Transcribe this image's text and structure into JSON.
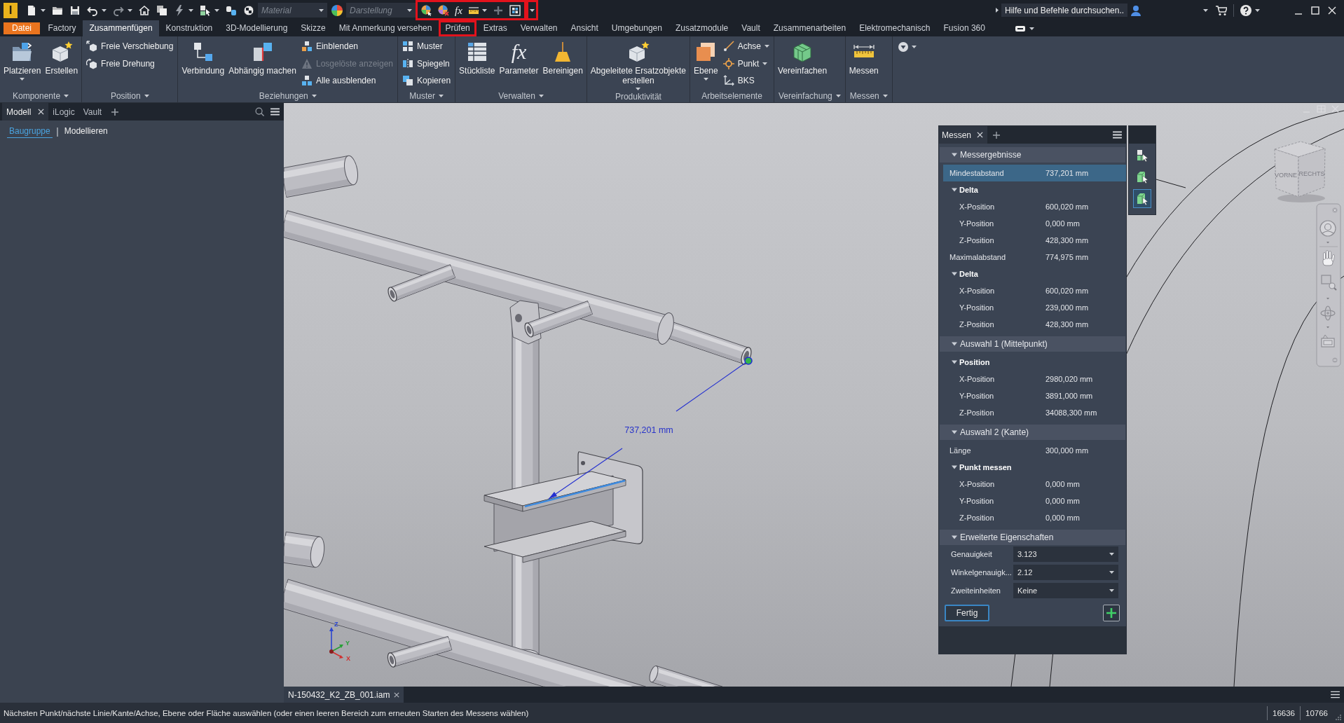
{
  "title_bar": {
    "app_logo": "I",
    "material": {
      "placeholder": "Material"
    },
    "appearance": {
      "placeholder": "Darstellung"
    },
    "quick_tools": {
      "highlighted": true,
      "formula_glyph": "fx"
    },
    "customize": {
      "highlighted": true
    },
    "search": {
      "placeholder": "Hilfe und Befehle durchsuchen.."
    }
  },
  "ribbon_tabs": [
    {
      "label": "Datei",
      "kind": "file",
      "selected": false,
      "highlighted": false
    },
    {
      "label": "Factory",
      "kind": "tab",
      "selected": false,
      "highlighted": false
    },
    {
      "label": "Zusammenfügen",
      "kind": "tab",
      "selected": true,
      "highlighted": false
    },
    {
      "label": "Konstruktion",
      "kind": "tab",
      "selected": false,
      "highlighted": false
    },
    {
      "label": "3D-Modellierung",
      "kind": "tab",
      "selected": false,
      "highlighted": false
    },
    {
      "label": "Skizze",
      "kind": "tab",
      "selected": false,
      "highlighted": false
    },
    {
      "label": "Mit Anmerkung versehen",
      "kind": "tab",
      "selected": false,
      "highlighted": false
    },
    {
      "label": "Prüfen",
      "kind": "tab",
      "selected": false,
      "highlighted": true
    },
    {
      "label": "Extras",
      "kind": "tab",
      "selected": false,
      "highlighted": false
    },
    {
      "label": "Verwalten",
      "kind": "tab",
      "selected": false,
      "highlighted": false
    },
    {
      "label": "Ansicht",
      "kind": "tab",
      "selected": false,
      "highlighted": false
    },
    {
      "label": "Umgebungen",
      "kind": "tab",
      "selected": false,
      "highlighted": false
    },
    {
      "label": "Zusatzmodule",
      "kind": "tab",
      "selected": false,
      "highlighted": false
    },
    {
      "label": "Vault",
      "kind": "tab",
      "selected": false,
      "highlighted": false
    },
    {
      "label": "Zusammenarbeiten",
      "kind": "tab",
      "selected": false,
      "highlighted": false
    },
    {
      "label": "Elektromechanisch",
      "kind": "tab",
      "selected": false,
      "highlighted": false
    },
    {
      "label": "Fusion 360",
      "kind": "tab",
      "selected": false,
      "highlighted": false
    }
  ],
  "ribbon_panels": [
    {
      "title": "Komponente",
      "menu": true,
      "buttons": [
        {
          "label": "Platzieren",
          "kind": "large",
          "menu": true,
          "disabled": false
        },
        {
          "label": "Erstellen",
          "kind": "large",
          "menu": false,
          "disabled": false
        }
      ]
    },
    {
      "title": "Position",
      "menu": true,
      "buttons": [
        {
          "label": "Freie Verschiebung",
          "kind": "small",
          "menu": false,
          "disabled": false
        },
        {
          "label": "Freie Drehung",
          "kind": "small",
          "menu": false,
          "disabled": false
        }
      ]
    },
    {
      "title": "Beziehungen",
      "menu": true,
      "buttons": [
        {
          "label": "Verbindung",
          "kind": "large",
          "menu": false,
          "disabled": false
        },
        {
          "label": "Abhängig machen",
          "kind": "large",
          "menu": false,
          "disabled": false
        },
        {
          "label": "Einblenden",
          "kind": "small",
          "menu": false,
          "disabled": false
        },
        {
          "label": "Losgelöste anzeigen",
          "kind": "small",
          "menu": false,
          "disabled": true
        },
        {
          "label": "Alle ausblenden",
          "kind": "small",
          "menu": false,
          "disabled": false
        }
      ]
    },
    {
      "title": "Muster",
      "menu": true,
      "buttons": [
        {
          "label": "Muster",
          "kind": "small",
          "menu": false,
          "disabled": false
        },
        {
          "label": "Spiegeln",
          "kind": "small",
          "menu": false,
          "disabled": false
        },
        {
          "label": "Kopieren",
          "kind": "small",
          "menu": false,
          "disabled": false
        }
      ]
    },
    {
      "title": "Verwalten",
      "menu": true,
      "buttons": [
        {
          "label": "Stückliste",
          "kind": "large",
          "menu": false,
          "disabled": false
        },
        {
          "label": "Parameter",
          "kind": "large",
          "menu": false,
          "disabled": false,
          "glyph": "fx"
        },
        {
          "label": "Bereinigen",
          "kind": "large",
          "menu": false,
          "disabled": false
        }
      ]
    },
    {
      "title": "Produktivität",
      "menu": false,
      "buttons": [
        {
          "label": "Abgeleitete Ersatzobjekte\nerstellen",
          "kind": "large",
          "menu": true,
          "disabled": false
        }
      ]
    },
    {
      "title": "Arbeitselemente",
      "menu": false,
      "buttons": [
        {
          "label": "Ebene",
          "kind": "large",
          "menu": true,
          "disabled": false
        },
        {
          "label": "Achse",
          "kind": "small",
          "menu": true,
          "disabled": false
        },
        {
          "label": "Punkt",
          "kind": "small",
          "menu": true,
          "disabled": false
        },
        {
          "label": "BKS",
          "kind": "small",
          "menu": false,
          "disabled": false
        }
      ]
    },
    {
      "title": "Vereinfachung",
      "menu": true,
      "buttons": [
        {
          "label": "Vereinfachen",
          "kind": "large",
          "menu": false,
          "disabled": false
        }
      ]
    },
    {
      "title": "Messen",
      "menu": true,
      "buttons": [
        {
          "label": "Messen",
          "kind": "large",
          "menu": false,
          "disabled": false
        }
      ]
    }
  ],
  "browser": {
    "tabs": [
      {
        "label": "Modell",
        "selected": true,
        "closable": true
      },
      {
        "label": "iLogic",
        "selected": false,
        "closable": false
      },
      {
        "label": "Vault",
        "selected": false,
        "closable": false
      }
    ],
    "views": [
      {
        "label": "Baugruppe",
        "selected": true
      },
      {
        "label": "Modellieren",
        "selected": false
      }
    ]
  },
  "viewport": {
    "dimension": "737,201 mm",
    "view_cube": [
      "VORNE",
      "RECHTS"
    ],
    "triad": [
      "Z",
      "Y",
      "X"
    ]
  },
  "measure_panel": {
    "title": "Messen",
    "selection_modes": [
      {
        "selected": false
      },
      {
        "selected": false
      },
      {
        "selected": true
      }
    ],
    "sections": [
      {
        "title": "Messergebnisse",
        "expanded": true,
        "rows": [
          {
            "kind": "value",
            "label": "Mindestabstand",
            "value": "737,201 mm",
            "selected": true
          },
          {
            "kind": "group",
            "label": "Delta",
            "expanded": true,
            "selected": false,
            "children": [
              {
                "kind": "value",
                "label": "X-Position",
                "value": "600,020 mm",
                "selected": false
              },
              {
                "kind": "value",
                "label": "Y-Position",
                "value": "0,000 mm",
                "selected": false
              },
              {
                "kind": "value",
                "label": "Z-Position",
                "value": "428,300 mm",
                "selected": false
              }
            ]
          },
          {
            "kind": "value",
            "label": "Maximalabstand",
            "value": "774,975 mm",
            "selected": false
          },
          {
            "kind": "group",
            "label": "Delta",
            "expanded": true,
            "selected": false,
            "children": [
              {
                "kind": "value",
                "label": "X-Position",
                "value": "600,020 mm",
                "selected": false
              },
              {
                "kind": "value",
                "label": "Y-Position",
                "value": "239,000 mm",
                "selected": false
              },
              {
                "kind": "value",
                "label": "Z-Position",
                "value": "428,300 mm",
                "selected": false
              }
            ]
          }
        ]
      },
      {
        "title": "Auswahl 1 (Mittelpunkt)",
        "expanded": true,
        "rows": [
          {
            "kind": "group",
            "label": "Position",
            "expanded": true,
            "selected": false,
            "children": [
              {
                "kind": "value",
                "label": "X-Position",
                "value": "2980,020 mm",
                "selected": false
              },
              {
                "kind": "value",
                "label": "Y-Position",
                "value": "3891,000 mm",
                "selected": false
              },
              {
                "kind": "value",
                "label": "Z-Position",
                "value": "34088,300 mm",
                "selected": false
              }
            ]
          }
        ]
      },
      {
        "title": "Auswahl 2 (Kante)",
        "expanded": true,
        "rows": [
          {
            "kind": "value",
            "label": "Länge",
            "value": "300,000 mm",
            "selected": false
          },
          {
            "kind": "group",
            "label": "Punkt messen",
            "expanded": true,
            "selected": false,
            "children": [
              {
                "kind": "value",
                "label": "X-Position",
                "value": "0,000 mm",
                "selected": false
              },
              {
                "kind": "value",
                "label": "Y-Position",
                "value": "0,000 mm",
                "selected": false
              },
              {
                "kind": "value",
                "label": "Z-Position",
                "value": "0,000 mm",
                "selected": false
              }
            ]
          }
        ]
      },
      {
        "title": "Erweiterte Eigenschaften",
        "expanded": true,
        "settings": [
          {
            "label": "Genauigkeit",
            "value": "3.123"
          },
          {
            "label": "Winkelgenauigk...",
            "value": "2.12"
          },
          {
            "label": "Zweiteinheiten",
            "value": "Keine"
          }
        ]
      }
    ],
    "done_button": "Fertig"
  },
  "document_tabs": [
    {
      "label": "N-150432_K2_ZB_001.iam",
      "selected": true
    }
  ],
  "status_bar": {
    "message": "Nächsten Punkt/nächste Linie/Kante/Achse, Ebene oder Fläche auswählen (oder einen leeren Bereich zum erneuten Starten des Messens wählen)",
    "values": [
      "16636",
      "10766"
    ]
  }
}
